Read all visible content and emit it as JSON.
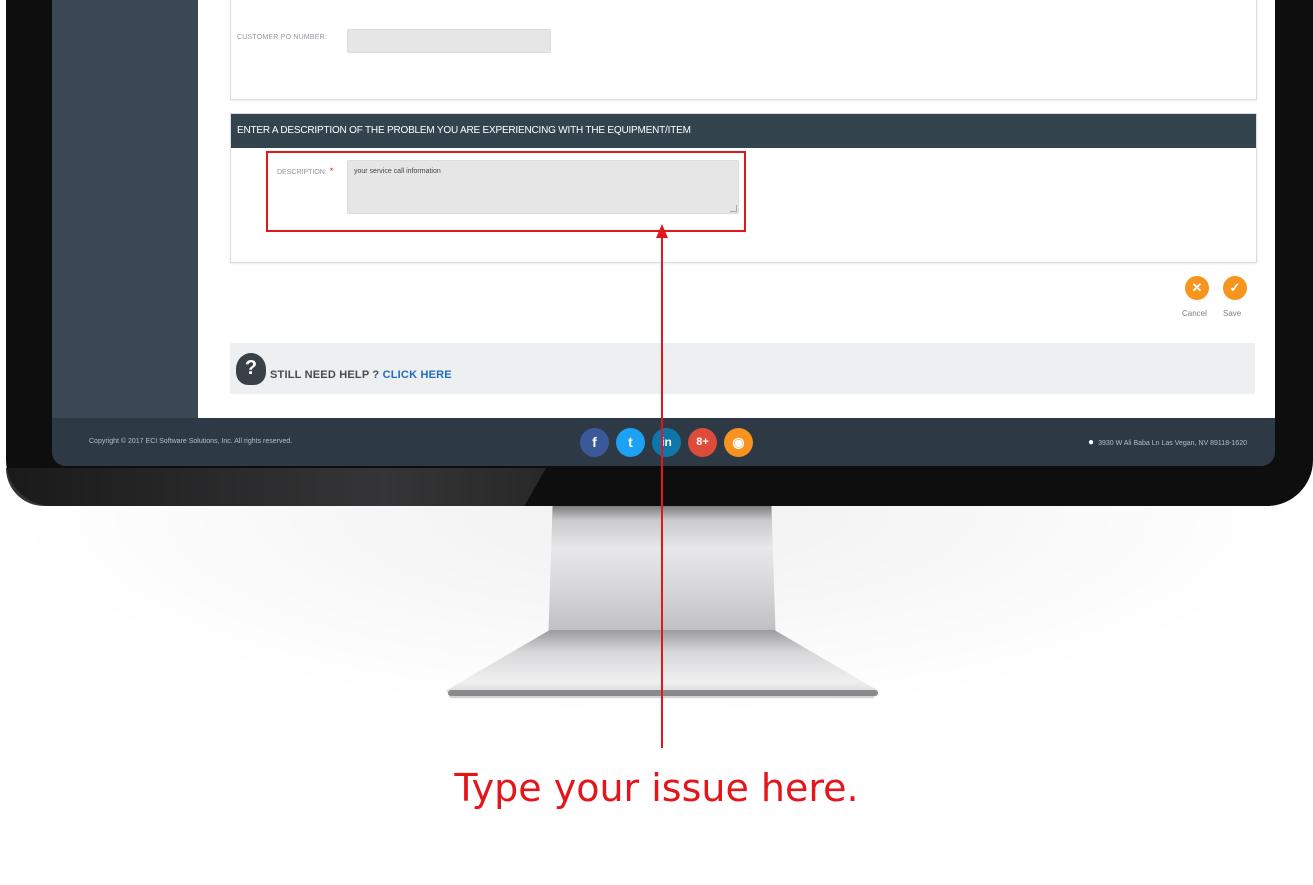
{
  "form": {
    "po_label": "CUSTOMER PO NUMBER:",
    "po_value": "",
    "section_title": "ENTER A DESCRIPTION OF THE PROBLEM YOU ARE EXPERIENCING WITH THE EQUIPMENT/ITEM",
    "description_label": "DESCRIPTION:",
    "required_marker": "*",
    "description_value": "your service call information"
  },
  "actions": {
    "cancel_label": "Cancel",
    "save_label": "Save",
    "cancel_glyph": "✕",
    "save_glyph": "✓"
  },
  "help": {
    "prefix": "STILL NEED HELP ? ",
    "link": "CLICK HERE",
    "icon_glyph": "?"
  },
  "footer": {
    "copyright": "Copyright © 2017 ECI Software Solutions, Inc. All rights reserved.",
    "address": "3930 W Ali Baba Ln Las Vegan, NV 89118-1620",
    "social": [
      {
        "name": "facebook",
        "glyph": "f",
        "color": "#3b5998"
      },
      {
        "name": "twitter",
        "glyph": "t",
        "color": "#1da1f2"
      },
      {
        "name": "linkedin",
        "glyph": "in",
        "color": "#0e76a8"
      },
      {
        "name": "google-plus",
        "glyph": "8+",
        "color": "#dd4b39"
      },
      {
        "name": "rss",
        "glyph": "◉",
        "color": "#f7931e"
      }
    ]
  },
  "annotation": {
    "text": "Type your issue here.",
    "color": "#e3161b"
  },
  "colors": {
    "accent": "#f7941d",
    "header_bg": "#34444f",
    "link": "#1f6dbf"
  }
}
